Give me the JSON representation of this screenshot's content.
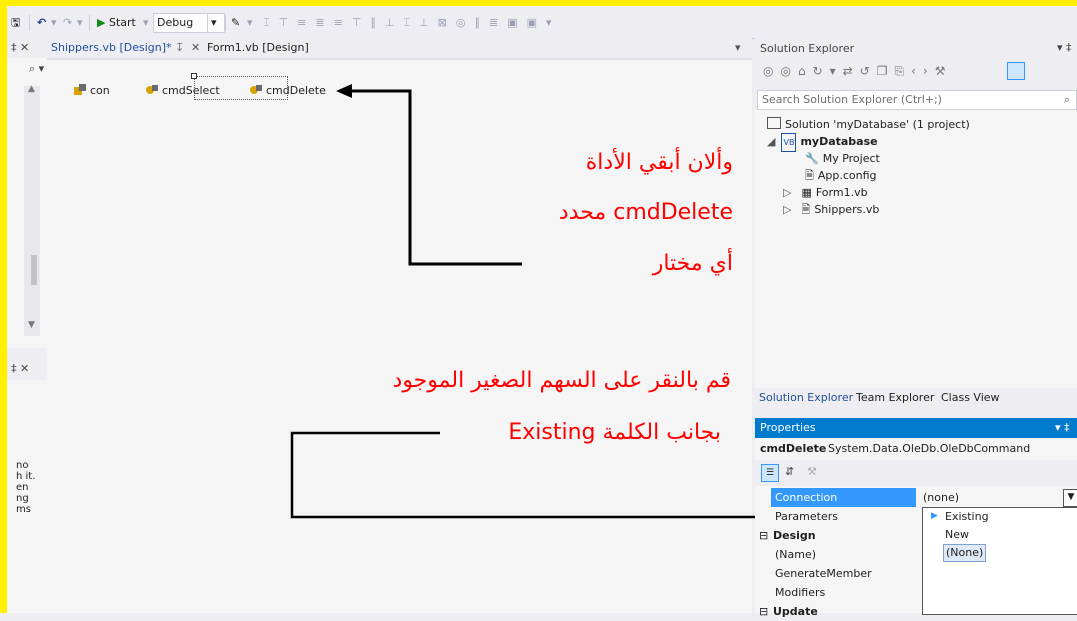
{
  "toolbar": {
    "start_label": "Start",
    "config_value": "Debug"
  },
  "left_panel": {
    "pin_close": "‡ ✕",
    "search_glyph": "⌕ ▾",
    "lower_pin_close": "‡ ✕",
    "fragments": [
      "no",
      "h it.",
      "en",
      "ng",
      "ms"
    ]
  },
  "tabs": [
    {
      "label": "Shippers.vb [Design]*",
      "active": false
    },
    {
      "label": "Form1.vb [Design]",
      "active": true
    }
  ],
  "designer": {
    "components": [
      {
        "label": "con",
        "icon": "connection-icon"
      },
      {
        "label": "cmdSelect",
        "icon": "command-icon"
      },
      {
        "label": "cmdDelete",
        "icon": "command-icon",
        "selected": true
      }
    ]
  },
  "annotations": {
    "note1_line1": "وألان أبقي الأداة",
    "note1_line2": "cmdDelete محدد",
    "note1_line3": "أي مختار",
    "note2_line1": "قم بالنقر على السهم الصغير الموجود",
    "note2_line2": "بجانب الكلمة Existing",
    "color": "#ff0000"
  },
  "solution_explorer": {
    "title": "Solution Explorer",
    "search_placeholder": "Search Solution Explorer (Ctrl+;)",
    "solution_label": "Solution 'myDatabase' (1 project)",
    "project_label": "myDatabase",
    "items": [
      "My Project",
      "App.config",
      "Form1.vb",
      "Shippers.vb"
    ],
    "tabs": [
      "Solution Explorer",
      "Team Explorer",
      "Class View"
    ]
  },
  "properties": {
    "title": "Properties",
    "object_name": "cmdDelete",
    "object_type": "System.Data.OleDb.OleDbCommand",
    "rows": [
      {
        "name": "Connection",
        "value": "(none)",
        "selected": true
      },
      {
        "name": "Parameters",
        "value": ""
      }
    ],
    "category_design": "Design",
    "design_rows": [
      "(Name)",
      "GenerateMember",
      "Modifiers"
    ],
    "category_update": "Update",
    "dropdown_items": [
      "Existing",
      "New",
      "(None)"
    ]
  }
}
